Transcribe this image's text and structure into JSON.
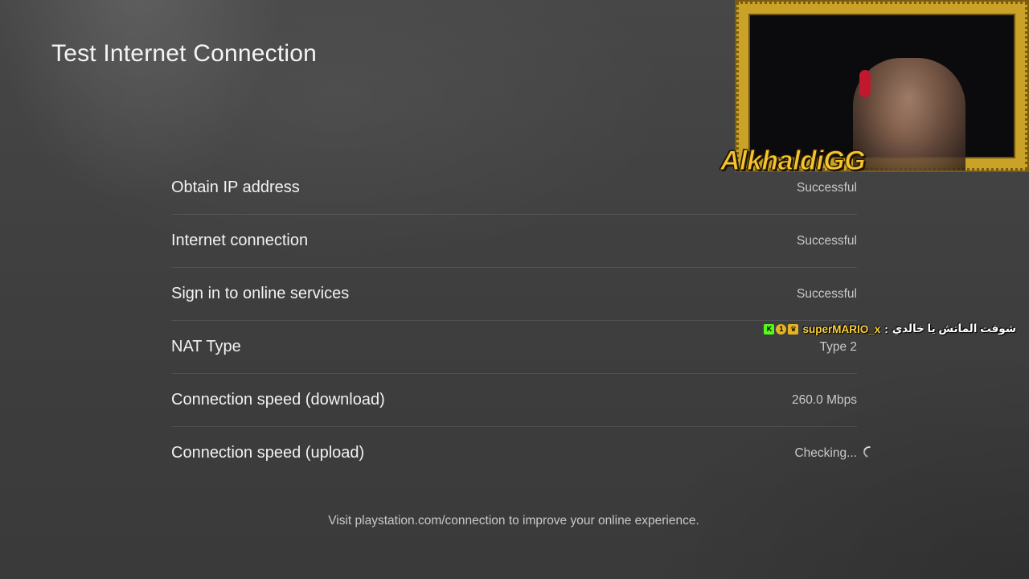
{
  "page": {
    "title": "Test Internet Connection"
  },
  "results": [
    {
      "label": "Obtain IP address",
      "value": "Successful"
    },
    {
      "label": "Internet connection",
      "value": "Successful"
    },
    {
      "label": "Sign in to online services",
      "value": "Successful"
    },
    {
      "label": "NAT Type",
      "value": "Type 2"
    },
    {
      "label": "Connection speed (download)",
      "value": "260.0 Mbps"
    },
    {
      "label": "Connection speed (upload)",
      "value": "Checking...",
      "loading": true
    }
  ],
  "footer": {
    "note": "Visit playstation.com/connection to improve your online experience."
  },
  "overlay": {
    "streamer_name": "AlkhaldiGG",
    "frame_color": "#c9a227",
    "chat": {
      "badges": [
        "K",
        "1",
        "♛"
      ],
      "username": "superMARIO_x",
      "separator": ":",
      "message": "شوفت الماتش يا خالدي"
    }
  }
}
